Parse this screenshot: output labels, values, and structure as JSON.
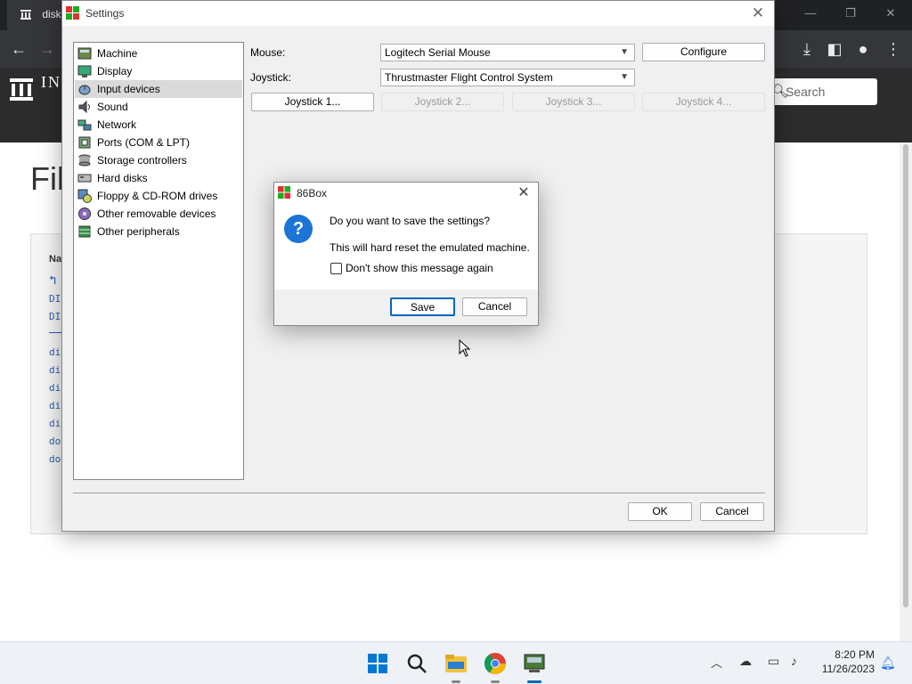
{
  "browser": {
    "tab_title": "disk-",
    "search_placeholder": "Search",
    "site_name": "IN AR",
    "page_title": "Fil",
    "listing": {
      "column": "Na",
      "rows": [
        "DI",
        "DI",
        "di",
        "di",
        "di",
        "di",
        "di",
        "do",
        "do"
      ]
    }
  },
  "settings": {
    "title": "Settings",
    "categories": [
      {
        "label": "Machine",
        "icon": "machine-icon"
      },
      {
        "label": "Display",
        "icon": "display-icon"
      },
      {
        "label": "Input devices",
        "icon": "input-devices-icon"
      },
      {
        "label": "Sound",
        "icon": "sound-icon"
      },
      {
        "label": "Network",
        "icon": "network-icon"
      },
      {
        "label": "Ports (COM & LPT)",
        "icon": "ports-icon"
      },
      {
        "label": "Storage controllers",
        "icon": "storage-controllers-icon"
      },
      {
        "label": "Hard disks",
        "icon": "hard-disks-icon"
      },
      {
        "label": "Floppy & CD-ROM drives",
        "icon": "floppy-cdrom-icon"
      },
      {
        "label": "Other removable devices",
        "icon": "removable-devices-icon"
      },
      {
        "label": "Other peripherals",
        "icon": "peripherals-icon"
      }
    ],
    "selected_category": "Input devices",
    "mouse_label": "Mouse:",
    "mouse_value": "Logitech Serial Mouse",
    "configure_label": "Configure",
    "joystick_label": "Joystick:",
    "joystick_value": "Thrustmaster Flight Control System",
    "joystick_buttons": [
      "Joystick 1...",
      "Joystick 2...",
      "Joystick 3...",
      "Joystick 4..."
    ],
    "ok_label": "OK",
    "cancel_label": "Cancel"
  },
  "dialog": {
    "title": "86Box",
    "message": "Do you want to save the settings?",
    "info": "This will hard reset the emulated machine.",
    "checkbox_label": "Don't show this message again",
    "save_label": "Save",
    "cancel_label": "Cancel"
  },
  "taskbar": {
    "time": "8:20 PM",
    "date": "11/26/2023"
  },
  "colors": {
    "accent": "#0067c0",
    "question_icon": "#1c74d4",
    "browser_chrome": "#35363a",
    "site_header": "#2c2c2c"
  }
}
